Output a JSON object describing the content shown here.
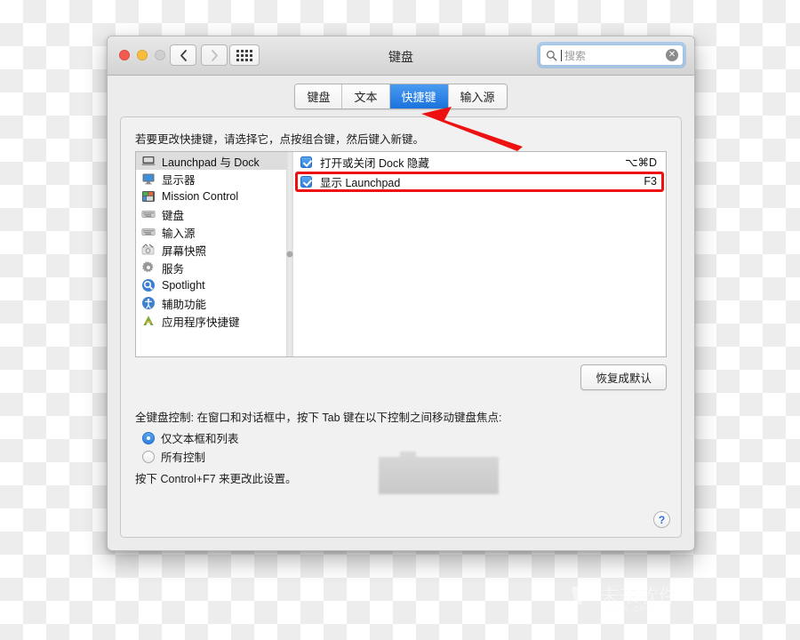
{
  "window": {
    "title": "键盘",
    "traffic_lights": [
      "close",
      "minimize",
      "zoom"
    ],
    "nav_back_icon": "chevron-left-icon",
    "nav_forward_icon": "chevron-right-icon",
    "grid_icon": "grid-view-icon"
  },
  "search": {
    "placeholder": "搜索",
    "value": "",
    "icon": "search-icon",
    "clear_icon": "clear-icon"
  },
  "tabs": [
    {
      "label": "键盘",
      "active": false
    },
    {
      "label": "文本",
      "active": false
    },
    {
      "label": "快捷键",
      "active": true
    },
    {
      "label": "输入源",
      "active": false
    }
  ],
  "main": {
    "instruction": "若要更改快捷键，请选择它，点按组合键，然后键入新键。",
    "restore_defaults_label": "恢复成默认",
    "full_keyboard_access_label": "全键盘控制: 在窗口和对话框中，按下 Tab 键在以下控制之间移动键盘焦点:",
    "hint": "按下 Control+F7 来更改此设置。",
    "help_label": "?"
  },
  "sidebar": {
    "items": [
      {
        "label": "Launchpad 与 Dock",
        "icon": "dock-icon",
        "selected": true
      },
      {
        "label": "显示器",
        "icon": "display-icon",
        "selected": false
      },
      {
        "label": "Mission Control",
        "icon": "mission-control-icon",
        "selected": false
      },
      {
        "label": "键盘",
        "icon": "keyboard-icon",
        "selected": false
      },
      {
        "label": "输入源",
        "icon": "input-source-icon",
        "selected": false
      },
      {
        "label": "屏幕快照",
        "icon": "screenshot-icon",
        "selected": false
      },
      {
        "label": "服务",
        "icon": "gear-icon",
        "selected": false
      },
      {
        "label": "Spotlight",
        "icon": "spotlight-icon",
        "selected": false
      },
      {
        "label": "辅助功能",
        "icon": "accessibility-icon",
        "selected": false
      },
      {
        "label": "应用程序快捷键",
        "icon": "app-shortcuts-icon",
        "selected": false
      }
    ]
  },
  "shortcuts": {
    "rows": [
      {
        "label": "打开或关闭 Dock 隐藏",
        "key": "⌥⌘D",
        "checked": true,
        "highlighted": false
      },
      {
        "label": "显示 Launchpad",
        "key": "F3",
        "checked": true,
        "highlighted": true
      }
    ]
  },
  "keyboard_access": {
    "options": [
      {
        "label": "仅文本框和列表",
        "selected": true
      },
      {
        "label": "所有控制",
        "selected": false
      }
    ]
  },
  "annotation": {
    "arrow_color": "#ee1111",
    "highlight_color": "#ee1111"
  },
  "watermark": {
    "text": "未来软件",
    "sub": "WWW.OFSO"
  }
}
